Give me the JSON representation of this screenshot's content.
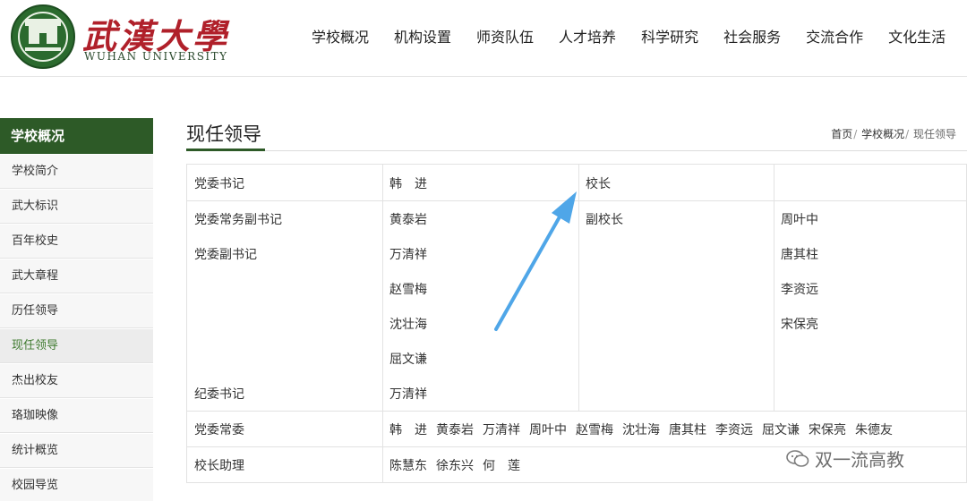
{
  "header": {
    "logo_cn": "武漢大學",
    "logo_en": "WUHAN UNIVERSITY",
    "seal_text": "WUHAN UNIVERSITY",
    "nav": [
      "学校概况",
      "机构设置",
      "师资队伍",
      "人才培养",
      "科学研究",
      "社会服务",
      "交流合作",
      "文化生活"
    ]
  },
  "sidebar": {
    "heading": "学校概况",
    "items": [
      "学校简介",
      "武大标识",
      "百年校史",
      "武大章程",
      "历任领导",
      "现任领导",
      "杰出校友",
      "珞珈映像",
      "统计概览",
      "校园导览"
    ],
    "active_index": 5
  },
  "main": {
    "title": "现任领导",
    "breadcrumb": [
      "首页",
      "学校概况",
      "现任领导"
    ]
  },
  "leaders": {
    "party_secretary_label": "党委书记",
    "party_secretary": "韩　进",
    "president_label": "校长",
    "president": "",
    "exec_deputy_secretary_label": "党委常务副书记",
    "deputy_secretary_label": "党委副书记",
    "deputy_secretaries": [
      "黄泰岩",
      "万清祥",
      "赵雪梅",
      "沈壮海",
      "屈文谦"
    ],
    "vice_president_label": "副校长",
    "vice_presidents": [
      "周叶中",
      "唐其柱",
      "李资远",
      "宋保亮"
    ],
    "discipline_secretary_label": "纪委书记",
    "discipline_secretary": "万清祥",
    "standing_committee_label": "党委常委",
    "standing_committee": [
      "韩　进",
      "黄泰岩",
      "万清祥",
      "周叶中",
      "赵雪梅",
      "沈壮海",
      "唐其柱",
      "李资远",
      "屈文谦",
      "宋保亮",
      "朱德友"
    ],
    "assistant_label": "校长助理",
    "assistants": [
      "陈慧东",
      "徐东兴",
      "何　莲"
    ]
  },
  "watermark": {
    "text": "双一流高教",
    "icon": "wechat-icon"
  },
  "colors": {
    "brand_green": "#2d5a27",
    "logo_red": "#b0202a",
    "active_text": "#3e7a2e",
    "arrow": "#4fa6e8"
  }
}
